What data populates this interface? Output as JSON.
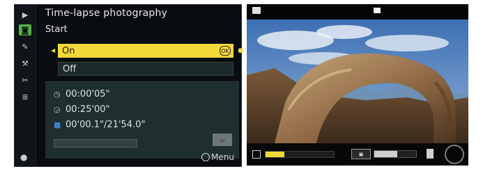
{
  "menu": {
    "title": "Time-lapse photography",
    "start_label": "Start",
    "options": [
      {
        "label": "On",
        "selected": true
      },
      {
        "label": "Off",
        "selected": false
      }
    ],
    "info": {
      "interval": "00:00'05\"",
      "shooting_time": "00:25'00\"",
      "movie_length": "00'00.1\"/21'54.0\""
    },
    "progress": 0.0,
    "hint_label": "Menu",
    "sidebar_icons": [
      "play-icon",
      "camera-icon",
      "pencil-icon",
      "wrench-icon",
      "retouch-icon",
      "list-icon",
      "help-icon"
    ]
  },
  "liveview": {
    "top_bracket_text": "",
    "recording_progress": 0.28,
    "icons": [
      "movie-mode-icon",
      "progress-bar",
      "badge",
      "volume-meter",
      "camera-icon",
      "dial-icon"
    ]
  },
  "colors": {
    "highlight": "#f3d83a",
    "active_tab": "#52b043",
    "panel": "#1f2e2f",
    "background": "#0a0d10"
  }
}
